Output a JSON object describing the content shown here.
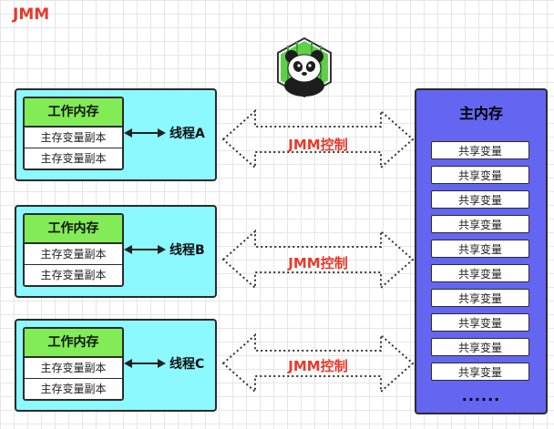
{
  "title": "JMM",
  "threads": [
    {
      "label": "线程A",
      "work_memory": "工作内存",
      "copies": [
        "主存变量副本",
        "主存变量副本"
      ],
      "jmm": "JMM控制"
    },
    {
      "label": "线程B",
      "work_memory": "工作内存",
      "copies": [
        "主存变量副本",
        "主存变量副本"
      ],
      "jmm": "JMM控制"
    },
    {
      "label": "线程C",
      "work_memory": "工作内存",
      "copies": [
        "主存变量副本",
        "主存变量副本"
      ],
      "jmm": "JMM控制"
    }
  ],
  "main_memory": {
    "title": "主内存",
    "shared": [
      "共享变量",
      "共享变量",
      "共享变量",
      "共享变量",
      "共享变量",
      "共享变量",
      "共享变量",
      "共享变量",
      "共享变量",
      "共享变量"
    ],
    "more": "......"
  },
  "colors": {
    "thread_bg": "#8cf8ff",
    "work_title_bg": "#82ec56",
    "main_bg": "#6466f2",
    "accent_red": "#e8392a"
  },
  "icons": {
    "logo": "panda-logo-icon"
  }
}
